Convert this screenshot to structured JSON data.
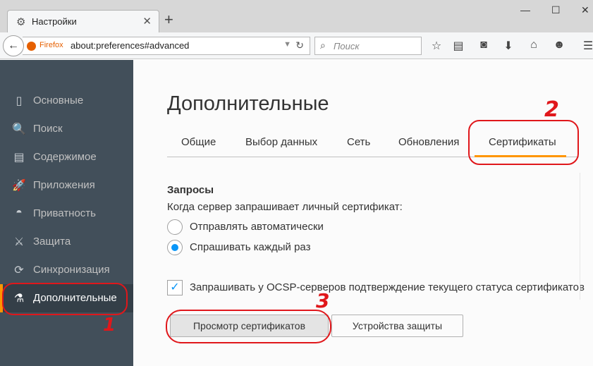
{
  "window": {
    "tab_title": "Настройки",
    "tab_close": "✕",
    "new_tab": "+",
    "minimize": "—",
    "maximize": "☐",
    "close": "✕"
  },
  "navbar": {
    "back": "←",
    "identity": "Firefox",
    "url": "about:preferences#advanced",
    "dropdown": "▼",
    "reload": "↻",
    "search_placeholder": "Поиск",
    "toolbar_icons": [
      "star-icon",
      "reading-list-icon",
      "pocket-icon",
      "download-icon",
      "home-icon",
      "smiley-icon",
      "menu-icon"
    ]
  },
  "sidebar": {
    "items": [
      {
        "label": "Основные",
        "icon": "▯",
        "active": false
      },
      {
        "label": "Поиск",
        "icon": "🔍",
        "active": false
      },
      {
        "label": "Содержимое",
        "icon": "▤",
        "active": false
      },
      {
        "label": "Приложения",
        "icon": "🚀",
        "active": false
      },
      {
        "label": "Приватность",
        "icon": "◓",
        "active": false
      },
      {
        "label": "Защита",
        "icon": "⚔",
        "active": false
      },
      {
        "label": "Синхронизация",
        "icon": "⟳",
        "active": false
      },
      {
        "label": "Дополнительные",
        "icon": "⚗",
        "active": true
      }
    ]
  },
  "main": {
    "heading": "Дополнительные",
    "tabs": [
      {
        "label": "Общие"
      },
      {
        "label": "Выбор данных"
      },
      {
        "label": "Сеть"
      },
      {
        "label": "Обновления"
      },
      {
        "label": "Сертификаты",
        "active": true
      }
    ],
    "section_title": "Запросы",
    "description": "Когда сервер запрашивает личный сертификат:",
    "radio_auto": "Отправлять автоматически",
    "radio_ask": "Спрашивать каждый раз",
    "ocsp_label": "Запрашивать у OCSP-серверов подтверждение текущего статуса сертификатов",
    "ocsp_checked": true,
    "btn_view_certs": "Просмотр сертификатов",
    "btn_security_devices": "Устройства защиты"
  },
  "annotations": {
    "n1": "1",
    "n2": "2",
    "n3": "3",
    "color": "#e0171b"
  },
  "colors": {
    "sidebar_bg": "#424f5a",
    "accent_orange": "#ff9500",
    "radio_blue": "#0996f8"
  }
}
